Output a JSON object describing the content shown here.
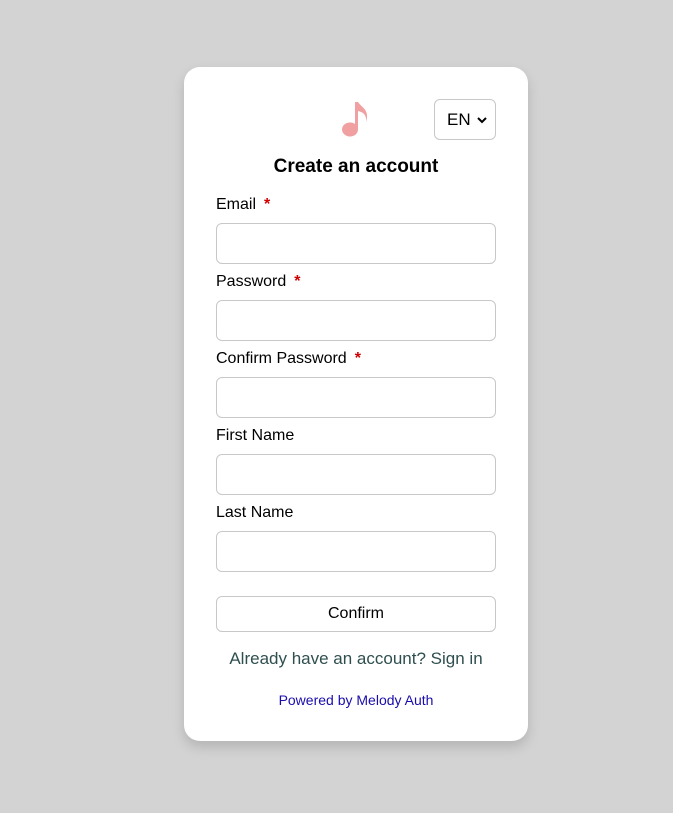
{
  "language": {
    "selected": "EN",
    "icon": "chevron-down-icon"
  },
  "logo": {
    "icon": "music-note-icon",
    "color": "#f0a0a0"
  },
  "form": {
    "title": "Create an account",
    "required_marker": "*",
    "fields": [
      {
        "label": "Email",
        "required": true,
        "value": "",
        "placeholder": ""
      },
      {
        "label": "Password",
        "required": true,
        "value": "",
        "placeholder": ""
      },
      {
        "label": "Confirm Password",
        "required": true,
        "value": "",
        "placeholder": ""
      },
      {
        "label": "First Name",
        "required": false,
        "value": "",
        "placeholder": ""
      },
      {
        "label": "Last Name",
        "required": false,
        "value": "",
        "placeholder": ""
      }
    ],
    "submit_label": "Confirm"
  },
  "footer": {
    "signin_prompt": "Already have an account?",
    "signin_link": "Sign in",
    "powered_by": "Powered by Melody Auth"
  }
}
